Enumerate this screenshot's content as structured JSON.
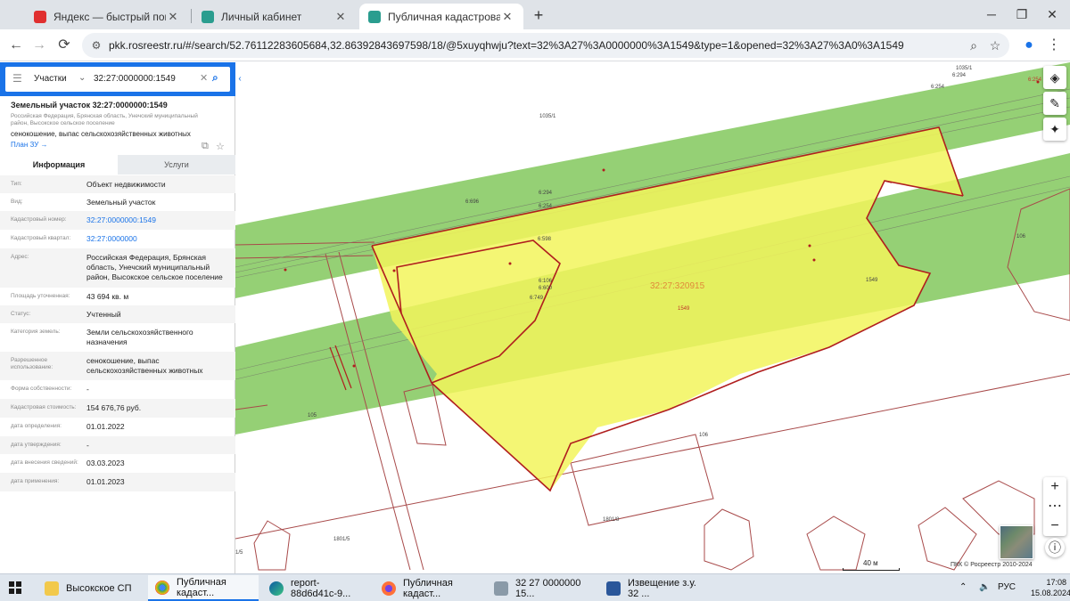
{
  "browser": {
    "tabs": [
      {
        "title": "Яндекс — быстрый поиск в ин",
        "active": false,
        "icon": "yandex-icon"
      },
      {
        "title": "Личный кабинет",
        "active": false,
        "icon": "rosreestr-icon"
      },
      {
        "title": "Публичная кадастровая карта",
        "active": true,
        "icon": "rosreestr-icon"
      }
    ],
    "url": "pkk.rosreestr.ru/#/search/52.76112283605684,32.86392843697598/18/@5xuyqhwju?text=32%3A27%3A0000000%3A1549&type=1&opened=32%3A27%3A0%3A1549"
  },
  "search": {
    "category": "Участки",
    "query": "32:27:0000000:1549"
  },
  "parcel": {
    "title": "Земельный участок 32:27:0000000:1549",
    "address_short": "Российская Федерация, Брянская область, Унечский муниципальный район, Высокское сельское поселение",
    "usage": "сенокошение, выпас сельскохозяйственных животных",
    "plan_link": "План ЗУ →",
    "tabs": [
      "Информация",
      "Услуги"
    ],
    "fields": [
      {
        "key": "Тип:",
        "value": "Объект недвижимости",
        "link": false
      },
      {
        "key": "Вид:",
        "value": "Земельный участок",
        "link": false
      },
      {
        "key": "Кадастровый номер:",
        "value": "32:27:0000000:1549",
        "link": true
      },
      {
        "key": "Кадастровый квартал:",
        "value": "32:27:0000000",
        "link": true
      },
      {
        "key": "Адрес:",
        "value": "Российская Федерация, Брянская область, Унечский муниципальный район, Высокское сельское поселение",
        "link": false
      },
      {
        "key": "Площадь уточненная:",
        "value": "43 694 кв. м",
        "link": false
      },
      {
        "key": "Статус:",
        "value": "Учтенный",
        "link": false
      },
      {
        "key": "Категория земель:",
        "value": "Земли сельскохозяйственного назначения",
        "link": false
      },
      {
        "key": "Разрешенное использование:",
        "value": "сенокошение, выпас сельскохозяйственных животных",
        "link": false
      },
      {
        "key": "Форма собственности:",
        "value": "-",
        "link": false
      },
      {
        "key": "Кадастровая стоимость:",
        "value": "154 676,76 руб.",
        "link": false
      },
      {
        "key": "дата определения:",
        "value": "01.01.2022",
        "link": false
      },
      {
        "key": "дата утверждения:",
        "value": "-",
        "link": false
      },
      {
        "key": "дата внесения сведений:",
        "value": "03.03.2023",
        "link": false
      },
      {
        "key": "дата применения:",
        "value": "01.01.2023",
        "link": false
      }
    ]
  },
  "map": {
    "labels": [
      {
        "text": "1035/1"
      },
      {
        "text": "6:294"
      },
      {
        "text": "6:254"
      },
      {
        "text": "6:696"
      },
      {
        "text": "6:294"
      },
      {
        "text": "6:254"
      },
      {
        "text": "6:598"
      },
      {
        "text": "6:106"
      },
      {
        "text": "6:600"
      },
      {
        "text": "6:749"
      },
      {
        "text": "32:27:320915"
      },
      {
        "text": "1549"
      },
      {
        "text": "1549"
      },
      {
        "text": "106"
      },
      {
        "text": "105"
      },
      {
        "text": "106"
      },
      {
        "text": "1801/8"
      },
      {
        "text": "1801/5"
      },
      {
        "text": "1/5"
      }
    ],
    "scale": "40 м",
    "copyright": "ПКК © Росреестр 2010-2024",
    "colors": {
      "green": "#8fce6e",
      "yellow": "#f2f55c",
      "border": "#b01e1e"
    }
  },
  "taskbar": {
    "items": [
      {
        "label": "Высокское СП",
        "icon": "folder-icon",
        "active": false
      },
      {
        "label": "Публичная кадаст...",
        "icon": "chrome-icon",
        "active": true
      },
      {
        "label": "report-88d6d41c-9...",
        "icon": "edge-icon",
        "active": false
      },
      {
        "label": "Публичная кадаст...",
        "icon": "firefox-icon",
        "active": false
      },
      {
        "label": "32 27 0000000 15...",
        "icon": "image-viewer-icon",
        "active": false
      },
      {
        "label": "Извещение з.у. 32 ...",
        "icon": "word-icon",
        "active": false
      }
    ],
    "lang": "РУС",
    "time": "17:08",
    "date": "15.08.2024"
  }
}
